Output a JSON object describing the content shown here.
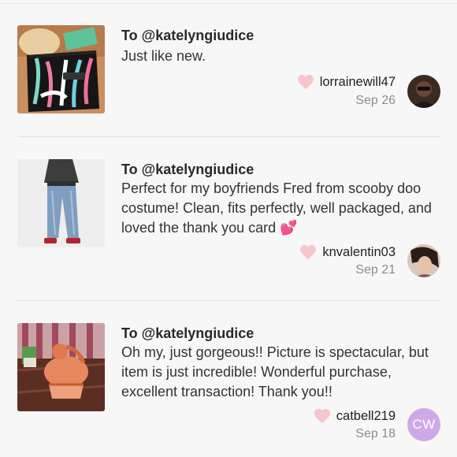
{
  "reviews": [
    {
      "to_label": "To @katelyngiudice",
      "message": "Just like new.",
      "username": "lorrainewill47",
      "date": "Sep 26",
      "avatar_initials": ""
    },
    {
      "to_label": "To @katelyngiudice",
      "message": "Perfect for my boyfriends Fred from scooby doo costume! Clean, fits perfectly, well packaged, and loved the thank you card 💕",
      "username": "knvalentin03",
      "date": "Sep 21",
      "avatar_initials": ""
    },
    {
      "to_label": "To @katelyngiudice",
      "message": "Oh my, just gorgeous!! Picture is spectacular, but item is just incredible! Wonderful purchase, excellent transaction! Thank you!!",
      "username": "catbell219",
      "date": "Sep 18",
      "avatar_initials": "CW"
    }
  ],
  "colors": {
    "heart": "#f7c6cc",
    "initials_avatar_bg": "#cfa9e6",
    "date": "#8d8d8d"
  }
}
